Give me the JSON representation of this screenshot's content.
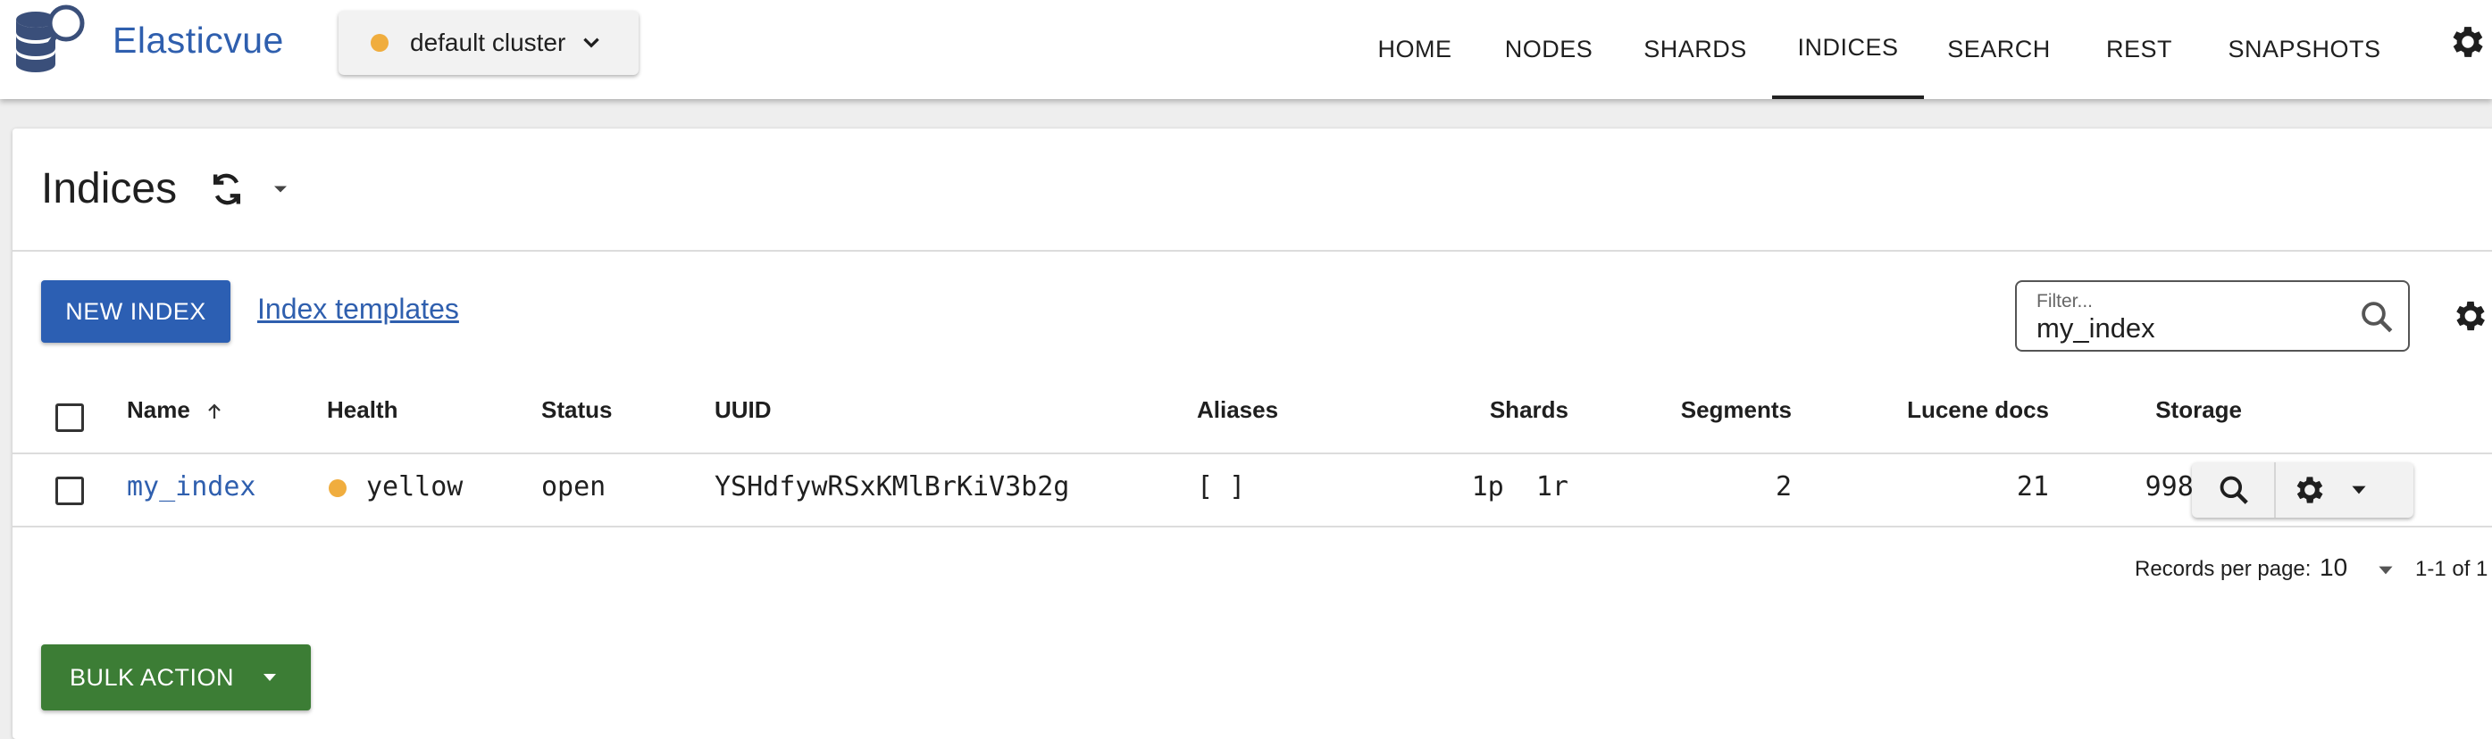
{
  "app": {
    "title": "Elasticvue"
  },
  "cluster": {
    "label": "default cluster",
    "status_color": "#f0ad3e"
  },
  "nav": {
    "items": [
      {
        "label": "HOME",
        "active": false
      },
      {
        "label": "NODES",
        "active": false
      },
      {
        "label": "SHARDS",
        "active": false
      },
      {
        "label": "INDICES",
        "active": true
      },
      {
        "label": "SEARCH",
        "active": false
      },
      {
        "label": "REST",
        "active": false
      },
      {
        "label": "SNAPSHOTS",
        "active": false
      }
    ]
  },
  "page": {
    "title": "Indices"
  },
  "toolbar": {
    "new_index_label": "NEW INDEX",
    "templates_link": "Index templates"
  },
  "filter": {
    "label": "Filter...",
    "value": "my_index"
  },
  "table": {
    "columns": {
      "name": "Name",
      "health": "Health",
      "status": "Status",
      "uuid": "UUID",
      "aliases": "Aliases",
      "shards": "Shards",
      "segments": "Segments",
      "lucene_docs": "Lucene docs",
      "storage": "Storage"
    },
    "sort": {
      "column": "Name",
      "direction": "ascending"
    },
    "rows": [
      {
        "name": "my_index",
        "health": "yellow",
        "health_color": "#f0ad3e",
        "status": "open",
        "uuid": "YSHdfywRSxKMlBrKiV3b2g",
        "aliases": "[ ]",
        "shards_p": "1p",
        "shards_r": "1r",
        "segments": "2",
        "lucene_docs": "21",
        "storage": "998 kB"
      }
    ]
  },
  "pagination": {
    "records_per_page_label": "Records per page:",
    "records_per_page": "10",
    "range": "1-1 of 1"
  },
  "bulk": {
    "label": "BULK ACTION"
  },
  "colors": {
    "primary": "#2c5fb3",
    "bulk": "#3c7d35",
    "link": "#2f5fae",
    "warning": "#f0ad3e"
  },
  "icons": [
    "database-search-logo-icon",
    "chevron-down-icon",
    "gear-icon",
    "refresh-icon",
    "caret-down-icon",
    "search-icon",
    "arrow-up-icon",
    "checkbox-icon"
  ]
}
